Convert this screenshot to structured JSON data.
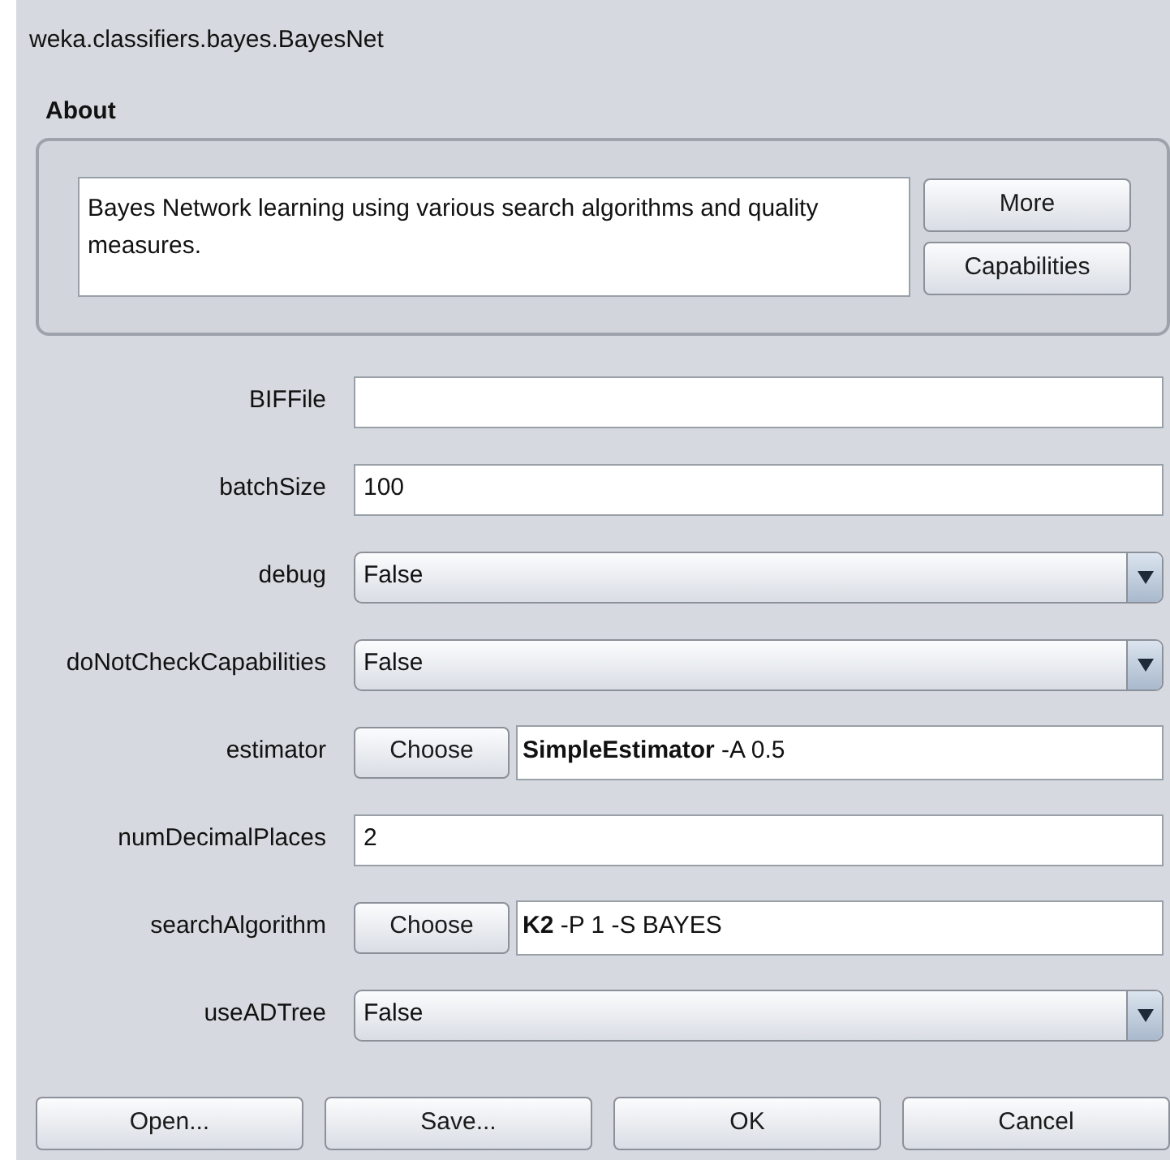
{
  "window": {
    "title": "weka.classifiers.bayes.BayesNet"
  },
  "about": {
    "heading": "About",
    "description": "Bayes Network learning using various search algorithms and quality measures.",
    "buttons": [
      "More",
      "Capabilities"
    ]
  },
  "properties": [
    {
      "kind": "text",
      "label": "BIFFile"
    },
    {
      "kind": "text",
      "label": "batchSize",
      "value": "100"
    },
    {
      "kind": "dropdown",
      "label": "debug",
      "value": "False"
    },
    {
      "kind": "dropdown",
      "label": "doNotCheckCapabilities",
      "value": "False"
    },
    {
      "kind": "chooser",
      "label": "estimator",
      "button": "Choose",
      "value": "**SimpleEstimator** -A 0.5"
    },
    {
      "kind": "text",
      "label": "numDecimalPlaces",
      "value": "2"
    },
    {
      "kind": "chooser",
      "label": "searchAlgorithm",
      "button": "Choose",
      "value": "**K2** -P 1 -S BAYES"
    },
    {
      "kind": "dropdown",
      "label": "useADTree",
      "value": "False"
    }
  ],
  "buttons": [
    "Open...",
    "Save...",
    "OK",
    "Cancel"
  ]
}
